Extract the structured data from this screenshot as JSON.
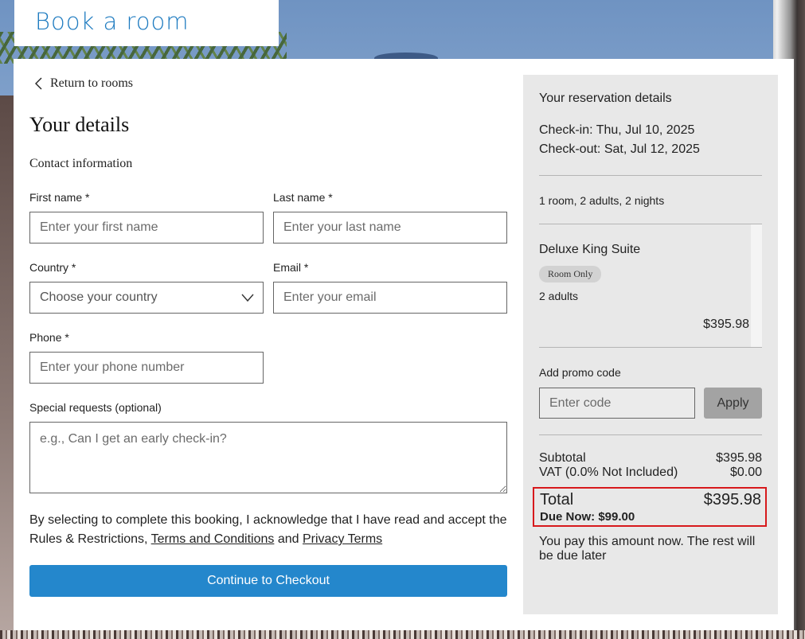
{
  "header": {
    "title": "Book a room"
  },
  "nav": {
    "back_label": "Return to rooms"
  },
  "form": {
    "heading": "Your details",
    "section": "Contact information",
    "first_name": {
      "label": "First name *",
      "placeholder": "Enter your first name"
    },
    "last_name": {
      "label": "Last name *",
      "placeholder": "Enter your last name"
    },
    "country": {
      "label": "Country *",
      "placeholder": "Choose your country"
    },
    "email": {
      "label": "Email *",
      "placeholder": "Enter your email"
    },
    "phone": {
      "label": "Phone *",
      "placeholder": "Enter your phone number"
    },
    "requests": {
      "label": "Special requests (optional)",
      "placeholder": "e.g., Can I get an early check-in?"
    },
    "legal": {
      "text_before": "By selecting to complete this booking, I acknowledge that I have read and accept the Rules & Restrictions, ",
      "terms_link": "Terms and Conditions",
      "and": " and ",
      "privacy_link": "Privacy Terms"
    },
    "continue_label": "Continue to Checkout"
  },
  "summary": {
    "title": "Your reservation details",
    "check_in": "Check-in: Thu, Jul 10, 2025",
    "check_out": "Check-out: Sat, Jul 12, 2025",
    "occupancy": "1 room, 2 adults, 2 nights",
    "room": {
      "name": "Deluxe King Suite",
      "rate_badge": "Room Only",
      "guests": "2 adults",
      "price": "$395.98"
    },
    "promo": {
      "label": "Add promo code",
      "placeholder": "Enter code",
      "apply_label": "Apply"
    },
    "subtotal": {
      "label": "Subtotal",
      "value": "$395.98"
    },
    "vat": {
      "label": "VAT (0.0% Not Included)",
      "value": "$0.00"
    },
    "total": {
      "label": "Total",
      "value": "$395.98"
    },
    "due_now": "Due Now: $99.00",
    "note": "You pay this amount now. The rest will be due later"
  },
  "colors": {
    "accent": "#2487cc",
    "title": "#1e7bc0",
    "highlight": "#d7191c",
    "panel": "#e8e8e8"
  }
}
